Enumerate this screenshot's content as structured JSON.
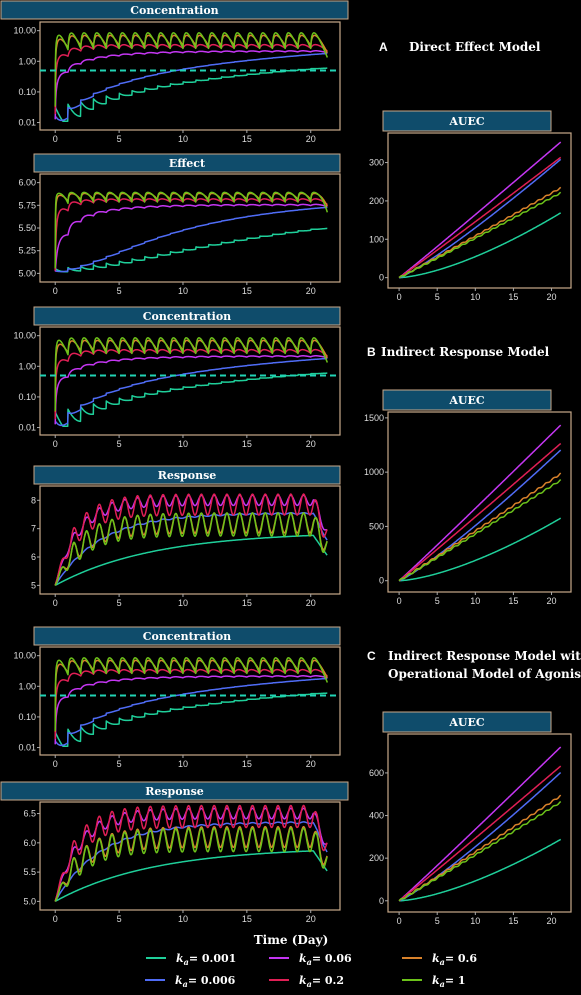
{
  "colors": {
    "background": "#000000",
    "title_bar": "#0f4c6b",
    "panel_border": "#c8a98a",
    "threshold_line": "#22d3b5",
    "series": {
      "0.001": "#1fcf9a",
      "0.006": "#4f6cf5",
      "0.06": "#c436f2",
      "0.2": "#e01f55",
      "0.6": "#d9822b",
      "1": "#6cc21a"
    }
  },
  "sections": [
    {
      "letter": "A",
      "title_lines": [
        "Direct Effect Model"
      ]
    },
    {
      "letter": "B",
      "title_lines": [
        "Indirect Response Model"
      ]
    },
    {
      "letter": "C",
      "title_lines": [
        "Indirect Response Model with",
        "Operational Model of Agonism"
      ]
    }
  ],
  "x_axis_title": "Time (Day)",
  "legend": {
    "symbol": "k",
    "subscript": "a",
    "entries": [
      {
        "key": "0.001",
        "text": "= 0.001"
      },
      {
        "key": "0.006",
        "text": "= 0.006"
      },
      {
        "key": "0.06",
        "text": "= 0.06"
      },
      {
        "key": "0.2",
        "text": "= 0.2"
      },
      {
        "key": "0.6",
        "text": "= 0.6"
      },
      {
        "key": "1",
        "text": "= 1"
      }
    ]
  },
  "chart_data": [
    {
      "id": "A-conc",
      "type": "line",
      "title": "Concentration",
      "log_y": true,
      "xlim": [
        0,
        21.5
      ],
      "ylim": [
        0.01,
        10
      ],
      "xticks": [
        "0",
        "5",
        "10",
        "15",
        "20"
      ],
      "yticks": [
        "0.01",
        "0.10",
        "1.00",
        "10.00"
      ],
      "threshold": 0.5,
      "model": "conc"
    },
    {
      "id": "A-effect",
      "type": "line",
      "title": "Effect",
      "log_y": false,
      "xlim": [
        0,
        21.5
      ],
      "ylim": [
        5.0,
        6.0
      ],
      "xticks": [
        "0",
        "5",
        "10",
        "15",
        "20"
      ],
      "yticks": [
        "5.00",
        "5.25",
        "5.50",
        "5.75",
        "6.00"
      ],
      "model": "effect"
    },
    {
      "id": "A-auec",
      "type": "line",
      "title": "AUEC",
      "log_y": false,
      "xlim": [
        0,
        21.5
      ],
      "ylim": [
        0,
        350
      ],
      "xticks": [
        "0",
        "5",
        "10",
        "15",
        "20"
      ],
      "yticks": [
        "0",
        "100",
        "200",
        "300"
      ],
      "model": "auec",
      "final_values": {
        "0.001": 170,
        "0.006": 310,
        "0.06": 355,
        "0.2": 315,
        "0.6": 235,
        "1": 222
      }
    },
    {
      "id": "B-conc",
      "type": "line",
      "title": "Concentration",
      "log_y": true,
      "xlim": [
        0,
        21.5
      ],
      "ylim": [
        0.01,
        10
      ],
      "xticks": [
        "0",
        "5",
        "10",
        "15",
        "20"
      ],
      "yticks": [
        "0.01",
        "0.10",
        "1.00",
        "10.00"
      ],
      "threshold": 0.5,
      "model": "conc"
    },
    {
      "id": "B-response",
      "type": "line",
      "title": "Response",
      "log_y": false,
      "xlim": [
        0,
        21.5
      ],
      "ylim": [
        5,
        8.2
      ],
      "xticks": [
        "0",
        "5",
        "10",
        "15",
        "20"
      ],
      "yticks": [
        "5",
        "6",
        "7",
        "8"
      ],
      "model": "response",
      "baseline": 5,
      "plateau": {
        "0.001": 6.9,
        "0.006": 7.55,
        "0.06": 8.0,
        "0.2": 7.85,
        "0.6": 7.2,
        "1": 7.15
      }
    },
    {
      "id": "B-auec",
      "type": "line",
      "title": "AUEC",
      "log_y": false,
      "xlim": [
        0,
        21.5
      ],
      "ylim": [
        0,
        1450
      ],
      "xticks": [
        "0",
        "5",
        "10",
        "15",
        "20"
      ],
      "yticks": [
        "0",
        "500",
        "1000",
        "1500"
      ],
      "model": "auec",
      "final_values": {
        "0.001": 580,
        "0.006": 1210,
        "0.06": 1440,
        "0.2": 1270,
        "0.6": 990,
        "1": 930
      }
    },
    {
      "id": "C-conc",
      "type": "line",
      "title": "Concentration",
      "log_y": true,
      "xlim": [
        0,
        21.5
      ],
      "ylim": [
        0.01,
        10
      ],
      "xticks": [
        "0",
        "5",
        "10",
        "15",
        "20"
      ],
      "yticks": [
        "0.01",
        "0.10",
        "1.00",
        "10.00"
      ],
      "threshold": 0.5,
      "model": "conc"
    },
    {
      "id": "C-response",
      "type": "line",
      "title": "Response",
      "log_y": false,
      "xlim": [
        0,
        21.5
      ],
      "ylim": [
        5,
        6.55
      ],
      "xticks": [
        "0",
        "5",
        "10",
        "15",
        "20"
      ],
      "yticks": [
        "5.0",
        "5.5",
        "6.0",
        "6.5"
      ],
      "model": "response",
      "baseline": 5,
      "plateau": {
        "0.001": 5.93,
        "0.006": 6.35,
        "0.06": 6.5,
        "0.2": 6.45,
        "0.6": 6.1,
        "1": 6.05
      }
    },
    {
      "id": "C-auec",
      "type": "line",
      "title": "AUEC",
      "log_y": false,
      "xlim": [
        0,
        21.5
      ],
      "ylim": [
        0,
        730
      ],
      "xticks": [
        "0",
        "5",
        "10",
        "15",
        "20"
      ],
      "yticks": [
        "0",
        "200",
        "400",
        "600"
      ],
      "model": "auec",
      "final_values": {
        "0.001": 290,
        "0.006": 605,
        "0.06": 725,
        "0.2": 635,
        "0.6": 495,
        "1": 465
      }
    }
  ]
}
